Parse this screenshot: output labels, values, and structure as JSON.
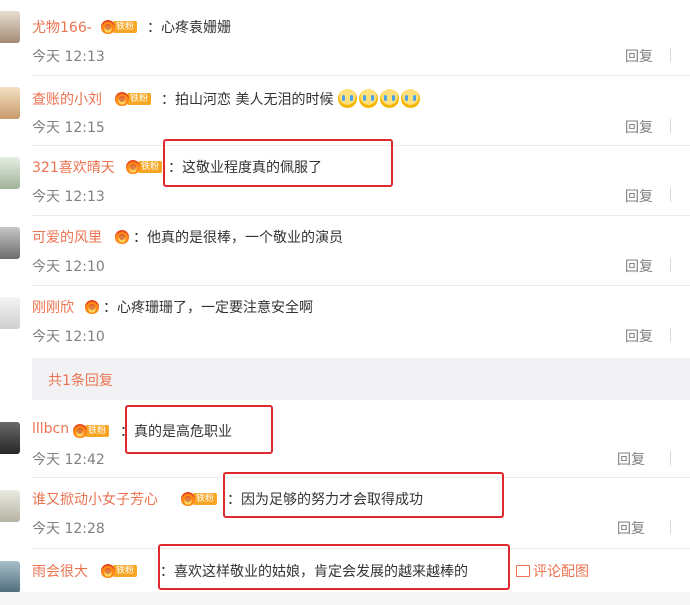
{
  "comments": [
    {
      "username": "尤物166-",
      "badge": "铁粉",
      "text": "心疼袁姗姗",
      "time": "今天 12:13",
      "reply": "回复",
      "avatar_color": "#c9b8a5"
    },
    {
      "username": "查账的小刘",
      "badge": "铁粉",
      "text": "拍山河恋 美人无泪的时候",
      "time": "今天 12:15",
      "reply": "回复",
      "avatar_color": "#d8b48a"
    },
    {
      "username": "321喜欢晴天",
      "badge": "铁粉",
      "text": "这敬业程度真的佩服了",
      "time": "今天 12:13",
      "reply": "回复",
      "avatar_color": "#b7c7b0"
    },
    {
      "username": "可爱的风里",
      "badge": "",
      "text": "他真的是很棒，一个敬业的演员",
      "time": "今天 12:10",
      "reply": "回复",
      "avatar_color": "#8e8e8e"
    },
    {
      "username": "刚刚欣",
      "badge": "",
      "text": "心疼珊珊了，一定要注意安全啊",
      "time": "今天 12:10",
      "reply": "回复",
      "avatar_color": "#e3e3e3"
    },
    {
      "username": "lllbcn",
      "badge": "铁粉",
      "text": "真的是高危职业",
      "time": "今天 12:42",
      "reply": "回复",
      "avatar_color": "#4a4a4a"
    },
    {
      "username": "谁又掀动小女子芳心",
      "badge": "铁粉",
      "text": "因为足够的努力才会取得成功",
      "time": "今天 12:28",
      "reply": "回复",
      "avatar_color": "#d5d3c8"
    },
    {
      "username": "雨会很大",
      "badge": "铁粉",
      "text": "喜欢这样敬业的姑娘，肯定会发展的越来越棒的",
      "time": "",
      "reply": "",
      "avatar_color": "#7f9aa8"
    }
  ],
  "total_replies": "共1条回复",
  "comment_with_image": "评论配图",
  "colors": {
    "accent": "#eb7350",
    "highlight": "#e0292f",
    "muted": "#808080"
  }
}
